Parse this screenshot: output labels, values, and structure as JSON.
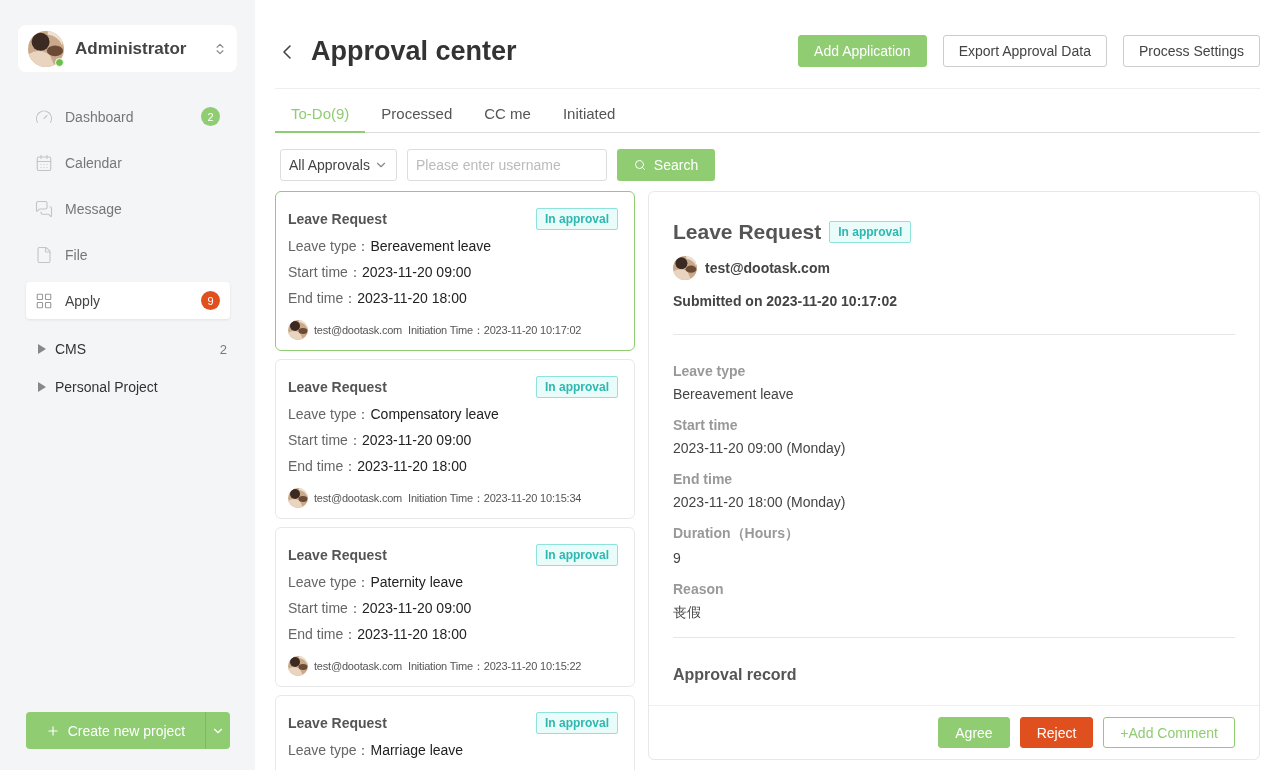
{
  "user": {
    "name": "Administrator",
    "online": true
  },
  "nav": [
    {
      "label": "Dashboard",
      "badge": "2",
      "color": "#8fcc72",
      "selected": false
    },
    {
      "label": "Calendar",
      "selected": false
    },
    {
      "label": "Message",
      "selected": false
    },
    {
      "label": "File",
      "selected": false
    },
    {
      "label": "Apply",
      "badge": "9",
      "color": "#e0501e",
      "selected": true
    }
  ],
  "projects": [
    {
      "name": "CMS",
      "count": "2",
      "expanded": false
    },
    {
      "name": "Personal Project",
      "expanded": false
    }
  ],
  "create_button": "Create new project",
  "page_title": "Approval center",
  "header_buttons": [
    {
      "label": "Add Application",
      "kind": "primary"
    },
    {
      "label": "Export Approval Data",
      "kind": "default"
    },
    {
      "label": "Process Settings",
      "kind": "default"
    }
  ],
  "tabs": [
    {
      "label": "To-Do(9)",
      "selected": true
    },
    {
      "label": "Processed",
      "selected": false
    },
    {
      "label": "CC me",
      "selected": false
    },
    {
      "label": "Initiated",
      "selected": false
    }
  ],
  "filter": {
    "type": "All Approvals",
    "placeholder": "Please enter username",
    "search": "Search"
  },
  "requests": [
    {
      "title": "Leave Request",
      "status": "In approval",
      "selected": true,
      "fields": [
        {
          "label": "Leave type：",
          "value": "Bereavement leave"
        },
        {
          "label": "Start time：",
          "value": "2023-11-20 09:00"
        },
        {
          "label": "End time：",
          "value": "2023-11-20 18:00"
        }
      ],
      "user": "test@dootask.com",
      "time_label": "Initiation Time：",
      "time": "2023-11-20 10:17:02"
    },
    {
      "title": "Leave Request",
      "status": "In approval",
      "selected": false,
      "fields": [
        {
          "label": "Leave type：",
          "value": "Compensatory leave"
        },
        {
          "label": "Start time：",
          "value": "2023-11-20 09:00"
        },
        {
          "label": "End time：",
          "value": "2023-11-20 18:00"
        }
      ],
      "user": "test@dootask.com",
      "time_label": "Initiation Time：",
      "time": "2023-11-20 10:15:34"
    },
    {
      "title": "Leave Request",
      "status": "In approval",
      "selected": false,
      "fields": [
        {
          "label": "Leave type：",
          "value": "Paternity leave"
        },
        {
          "label": "Start time：",
          "value": "2023-11-20 09:00"
        },
        {
          "label": "End time：",
          "value": "2023-11-20 18:00"
        }
      ],
      "user": "test@dootask.com",
      "time_label": "Initiation Time：",
      "time": "2023-11-20 10:15:22"
    },
    {
      "title": "Leave Request",
      "status": "In approval",
      "selected": false,
      "fields": [
        {
          "label": "Leave type：",
          "value": "Marriage leave"
        }
      ]
    }
  ],
  "detail": {
    "title": "Leave Request",
    "status": "In approval",
    "user": "test@dootask.com",
    "submitted": "Submitted on 2023-11-20 10:17:02",
    "fields": [
      {
        "label": "Leave type",
        "value": "Bereavement leave"
      },
      {
        "label": "Start time",
        "value": "2023-11-20 09:00 (Monday)"
      },
      {
        "label": "End time",
        "value": "2023-11-20 18:00 (Monday)"
      },
      {
        "label": "Duration（Hours）",
        "value": "9"
      },
      {
        "label": "Reason",
        "value": "丧假"
      }
    ],
    "record_title": "Approval record",
    "actions": [
      {
        "label": "Agree",
        "kind": "primary"
      },
      {
        "label": "Reject",
        "kind": "danger"
      },
      {
        "label": "+Add Comment",
        "kind": "outline"
      }
    ]
  }
}
